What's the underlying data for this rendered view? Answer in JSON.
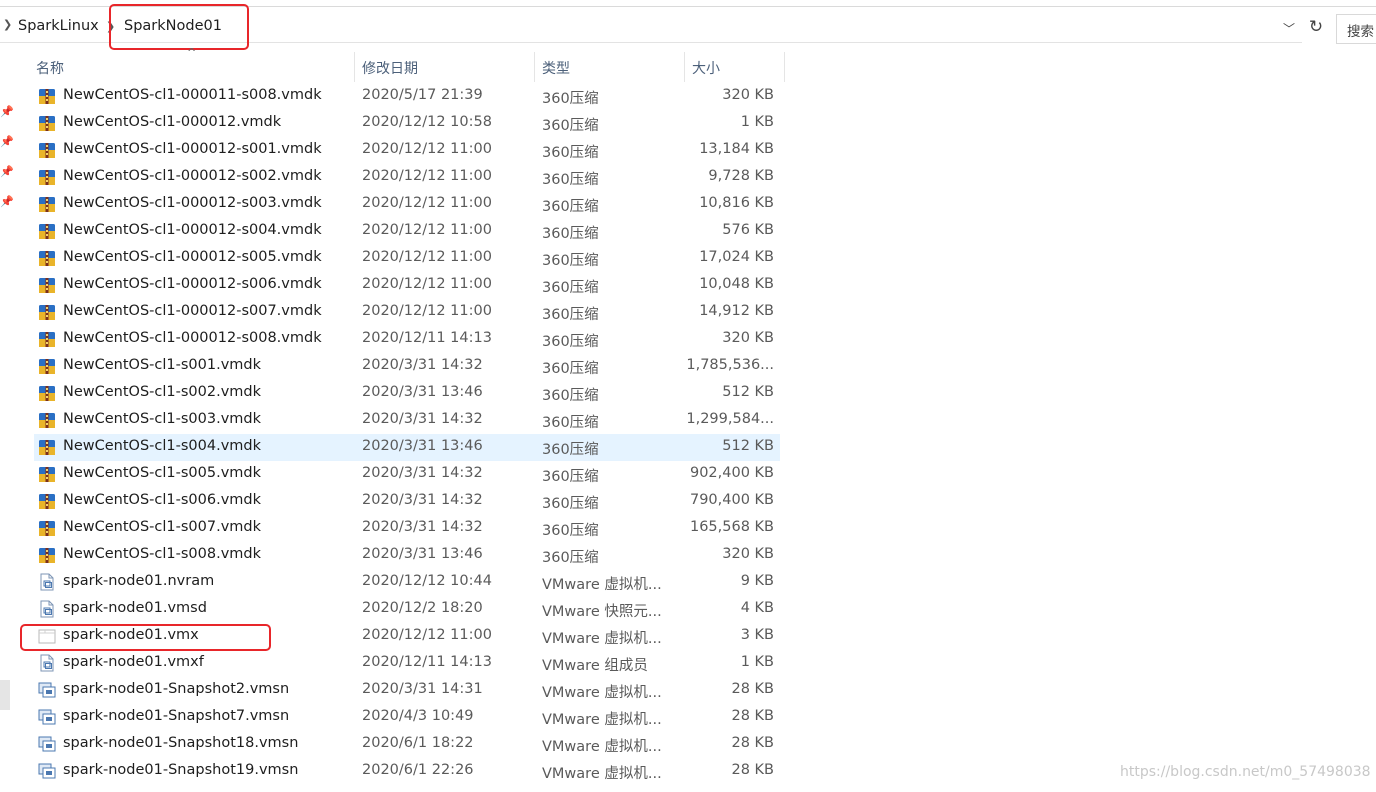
{
  "address": {
    "crumbs": [
      "SparkLinux",
      "SparkNode01"
    ],
    "search_placeholder": "搜索"
  },
  "columns": {
    "name": "名称",
    "date": "修改日期",
    "type": "类型",
    "size": "大小"
  },
  "files": [
    {
      "name": "NewCentOS-cl1-000011-s008.vmdk",
      "date": "2020/5/17 21:39",
      "type": "360压缩",
      "size": "320 KB",
      "icon": "archive"
    },
    {
      "name": "NewCentOS-cl1-000012.vmdk",
      "date": "2020/12/12 10:58",
      "type": "360压缩",
      "size": "1 KB",
      "icon": "archive"
    },
    {
      "name": "NewCentOS-cl1-000012-s001.vmdk",
      "date": "2020/12/12 11:00",
      "type": "360压缩",
      "size": "13,184 KB",
      "icon": "archive"
    },
    {
      "name": "NewCentOS-cl1-000012-s002.vmdk",
      "date": "2020/12/12 11:00",
      "type": "360压缩",
      "size": "9,728 KB",
      "icon": "archive"
    },
    {
      "name": "NewCentOS-cl1-000012-s003.vmdk",
      "date": "2020/12/12 11:00",
      "type": "360压缩",
      "size": "10,816 KB",
      "icon": "archive"
    },
    {
      "name": "NewCentOS-cl1-000012-s004.vmdk",
      "date": "2020/12/12 11:00",
      "type": "360压缩",
      "size": "576 KB",
      "icon": "archive"
    },
    {
      "name": "NewCentOS-cl1-000012-s005.vmdk",
      "date": "2020/12/12 11:00",
      "type": "360压缩",
      "size": "17,024 KB",
      "icon": "archive"
    },
    {
      "name": "NewCentOS-cl1-000012-s006.vmdk",
      "date": "2020/12/12 11:00",
      "type": "360压缩",
      "size": "10,048 KB",
      "icon": "archive"
    },
    {
      "name": "NewCentOS-cl1-000012-s007.vmdk",
      "date": "2020/12/12 11:00",
      "type": "360压缩",
      "size": "14,912 KB",
      "icon": "archive"
    },
    {
      "name": "NewCentOS-cl1-000012-s008.vmdk",
      "date": "2020/12/11 14:13",
      "type": "360压缩",
      "size": "320 KB",
      "icon": "archive"
    },
    {
      "name": "NewCentOS-cl1-s001.vmdk",
      "date": "2020/3/31 14:32",
      "type": "360压缩",
      "size": "1,785,536...",
      "icon": "archive"
    },
    {
      "name": "NewCentOS-cl1-s002.vmdk",
      "date": "2020/3/31 13:46",
      "type": "360压缩",
      "size": "512 KB",
      "icon": "archive"
    },
    {
      "name": "NewCentOS-cl1-s003.vmdk",
      "date": "2020/3/31 14:32",
      "type": "360压缩",
      "size": "1,299,584...",
      "icon": "archive"
    },
    {
      "name": "NewCentOS-cl1-s004.vmdk",
      "date": "2020/3/31 13:46",
      "type": "360压缩",
      "size": "512 KB",
      "icon": "archive",
      "selected": true
    },
    {
      "name": "NewCentOS-cl1-s005.vmdk",
      "date": "2020/3/31 14:32",
      "type": "360压缩",
      "size": "902,400 KB",
      "icon": "archive"
    },
    {
      "name": "NewCentOS-cl1-s006.vmdk",
      "date": "2020/3/31 14:32",
      "type": "360压缩",
      "size": "790,400 KB",
      "icon": "archive"
    },
    {
      "name": "NewCentOS-cl1-s007.vmdk",
      "date": "2020/3/31 14:32",
      "type": "360压缩",
      "size": "165,568 KB",
      "icon": "archive"
    },
    {
      "name": "NewCentOS-cl1-s008.vmdk",
      "date": "2020/3/31 13:46",
      "type": "360压缩",
      "size": "320 KB",
      "icon": "archive"
    },
    {
      "name": "spark-node01.nvram",
      "date": "2020/12/12 10:44",
      "type": "VMware 虚拟机...",
      "size": "9 KB",
      "icon": "vmware-doc"
    },
    {
      "name": "spark-node01.vmsd",
      "date": "2020/12/2 18:20",
      "type": "VMware 快照元...",
      "size": "4 KB",
      "icon": "vmware-doc"
    },
    {
      "name": "spark-node01.vmx",
      "date": "2020/12/12 11:00",
      "type": "VMware 虚拟机...",
      "size": "3 KB",
      "icon": "vmx-blank"
    },
    {
      "name": "spark-node01.vmxf",
      "date": "2020/12/11 14:13",
      "type": "VMware 组成员",
      "size": "1 KB",
      "icon": "vmware-doc"
    },
    {
      "name": "spark-node01-Snapshot2.vmsn",
      "date": "2020/3/31 14:31",
      "type": "VMware 虚拟机...",
      "size": "28 KB",
      "icon": "vmware-snap"
    },
    {
      "name": "spark-node01-Snapshot7.vmsn",
      "date": "2020/4/3 10:49",
      "type": "VMware 虚拟机...",
      "size": "28 KB",
      "icon": "vmware-snap"
    },
    {
      "name": "spark-node01-Snapshot18.vmsn",
      "date": "2020/6/1 18:22",
      "type": "VMware 虚拟机...",
      "size": "28 KB",
      "icon": "vmware-snap"
    },
    {
      "name": "spark-node01-Snapshot19.vmsn",
      "date": "2020/6/1 22:26",
      "type": "VMware 虚拟机...",
      "size": "28 KB",
      "icon": "vmware-snap"
    }
  ],
  "watermark": "https://blog.csdn.net/m0_57498038",
  "colors": {
    "highlight_red": "#e8262a",
    "selected_row": "#e5f3ff",
    "header_text": "#4c607a"
  }
}
